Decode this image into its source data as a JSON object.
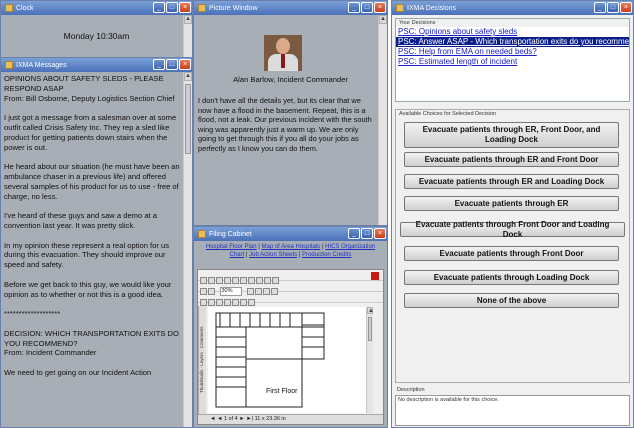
{
  "clock": {
    "title": "Clock",
    "time": "Monday 10:30am"
  },
  "messages": {
    "title": "IXMA Messages",
    "text": "OPINIONS ABOUT SAFETY SLEDS - PLEASE RESPOND ASAP\nFrom: Bill Osborne, Deputy Logistics Section Chief\n\nI just got a message from a salesman over at some outfit called Crisis Safety Inc. They rep a sled like product for getting patients down stairs when the power is out.\n\nHe heard about our situation (he must have been an ambulance chaser in a previous life) and offered several samples of his product for us to use - free of charge, no less.\n\nI've heard of these guys and saw a demo at a convention last year. It was pretty slick.\n\nIn my opinion these represent a real option for us during this evacuation. They should improve our speed and safety.\n\nBefore we get back to this guy, we would like your opinion as to whether or not this is a good idea.\n\n*******************\n\nDECISION: WHICH TRANSPORTATION EXITS DO YOU RECOMMEND?\nFrom: Incident Commander\n\nWe need to get going on our Incident Action"
  },
  "picture": {
    "title": "Picture Window",
    "caption": "Alan Barlow, Incident Commander",
    "text": "I don't have all the details yet, but its clear that we now have a flood in the basement. Repeat, this is a flood, not a leak. Our previous incident with the south wing was apparently just a warm up. We are only going to get through this if you all do your jobs as perfectly as I know you can do them."
  },
  "filing": {
    "title": "Filing Cabinet",
    "links": [
      "Hospital Floor Plan",
      "Map of Area Hospitals",
      "HICS Organization Chart",
      "Job Action Sheets",
      "Production Credits"
    ],
    "zoom": "30%",
    "page": "1 of 4",
    "size": "11 x 23.36 in",
    "floor_label": "First Floor",
    "side_tabs": [
      "Thumbnails",
      "Layers",
      "Comments"
    ]
  },
  "decisions": {
    "title": "IXMA Decisions",
    "section_label": "Your Decisions",
    "items": [
      {
        "label": "PSC: Opinions about safety sleds",
        "selected": false
      },
      {
        "label": "PSC: Answer ASAP - Which transportation exits do you recommend?",
        "selected": true
      },
      {
        "label": "PSC: Help from EMA on needed beds?",
        "selected": false
      },
      {
        "label": "PSC: Estimated length of incident",
        "selected": false
      }
    ],
    "choices_label": "Available Choices for Selected Decision",
    "choices": [
      "Evacuate patients through ER, Front Door, and Loading Dock",
      "Evacuate patients through ER and Front Door",
      "Evacuate patients through ER and Loading Dock",
      "Evacuate patients through ER",
      "Evacuate patients through Front Door and Loading Dock",
      "Evacuate patients through Front Door",
      "Evacuate patients through Loading Dock",
      "None of the above"
    ],
    "description_label": "Description",
    "description": "No description is available for this choice."
  }
}
